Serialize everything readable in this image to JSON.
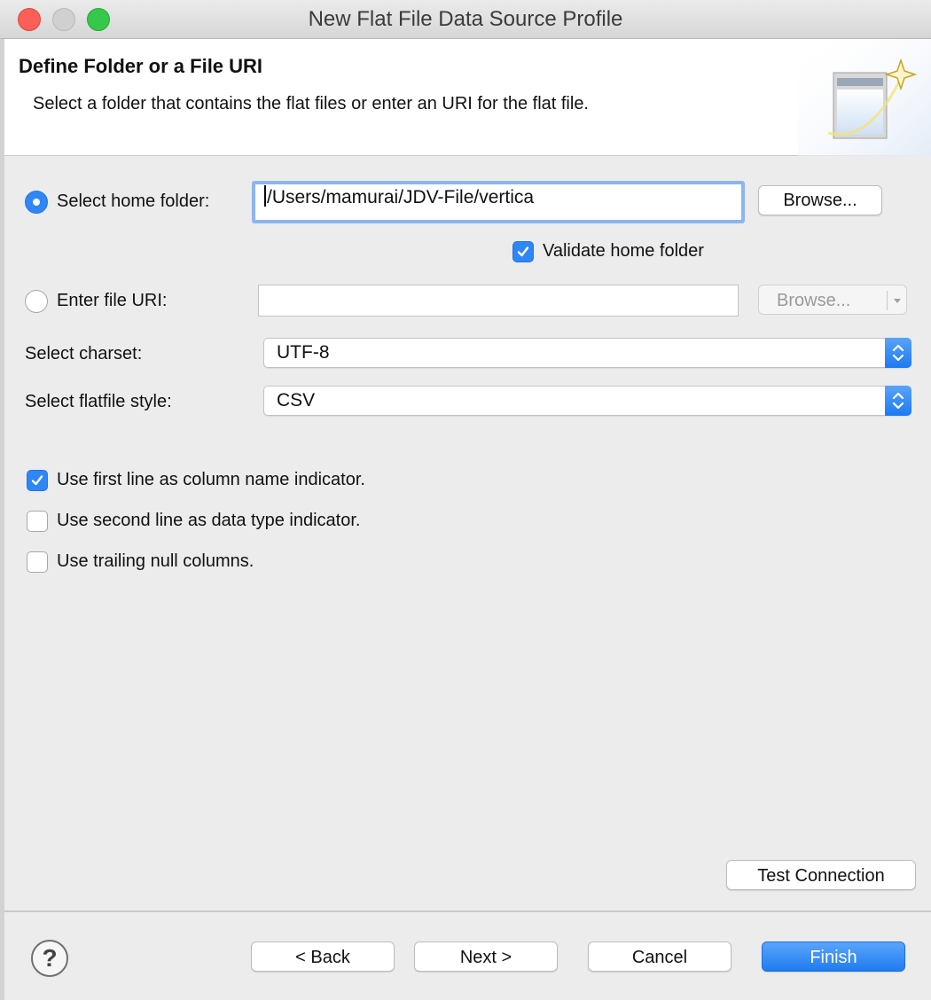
{
  "window": {
    "title": "New Flat File Data Source Profile",
    "traffic_lights": {
      "close_color": "#fc5f57",
      "minimize_color": "#d0d0d0",
      "maximize_color": "#35c84a"
    }
  },
  "banner": {
    "heading": "Define Folder or a File URI",
    "description": "Select a folder that contains the flat files or enter an URI for the flat file.",
    "icon": "wizard-window-sparkle-icon"
  },
  "form": {
    "home_folder": {
      "label": "Select home folder:",
      "selected": true,
      "value": "/Users/mamurai/JDV-File/vertica",
      "browse_label": "Browse..."
    },
    "validate_home_folder": {
      "label": "Validate home folder",
      "checked": true
    },
    "file_uri": {
      "label": "Enter file URI:",
      "selected": false,
      "value": "",
      "browse_label": "Browse..."
    },
    "charset": {
      "label": "Select charset:",
      "value": "UTF-8"
    },
    "flatfile_style": {
      "label": "Select flatfile style:",
      "value": "CSV"
    },
    "options": [
      {
        "label": "Use first line as column name indicator.",
        "checked": true
      },
      {
        "label": "Use second line as data type indicator.",
        "checked": false
      },
      {
        "label": "Use trailing null columns.",
        "checked": false
      }
    ],
    "test_connection_label": "Test Connection"
  },
  "footer": {
    "help_symbol": "?",
    "back_label": "< Back",
    "next_label": "Next >",
    "cancel_label": "Cancel",
    "finish_label": "Finish"
  },
  "colors": {
    "accent": "#2f86f6",
    "focus_ring": "#8db5ee"
  }
}
